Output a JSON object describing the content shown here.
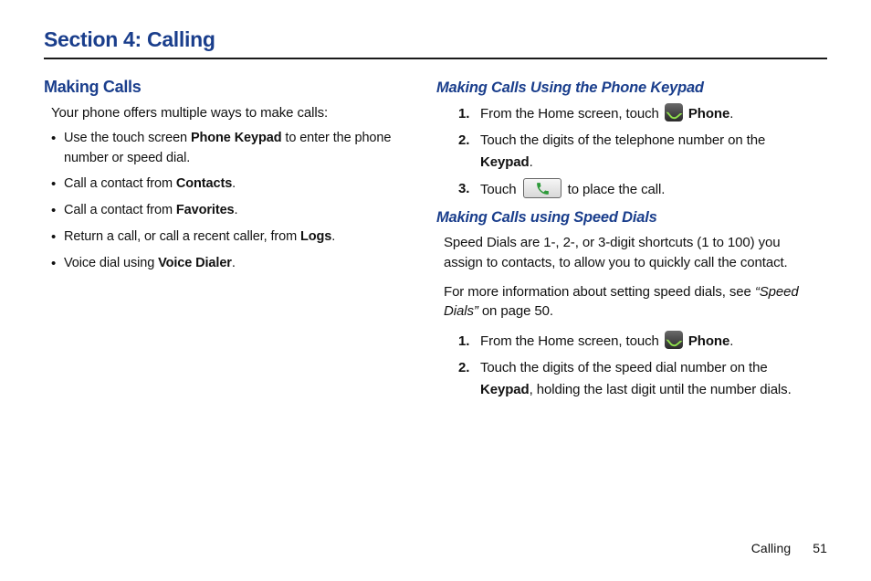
{
  "section_title": "Section 4: Calling",
  "left": {
    "h2": "Making Calls",
    "intro": "Your phone offers multiple ways to make calls:",
    "bullets": [
      {
        "pre": "Use the touch screen ",
        "bold": "Phone Keypad",
        "post": " to enter the phone number or speed dial."
      },
      {
        "pre": "Call a contact from ",
        "bold": "Contacts",
        "post": "."
      },
      {
        "pre": "Call a contact from ",
        "bold": "Favorites",
        "post": "."
      },
      {
        "pre": "Return a call, or call a recent caller, from ",
        "bold": "Logs",
        "post": "."
      },
      {
        "pre": "Voice dial using ",
        "bold": "Voice Dialer",
        "post": "."
      }
    ]
  },
  "right": {
    "sub1": {
      "h3": "Making Calls Using the Phone Keypad",
      "steps": {
        "s1_pre": "From the Home screen, touch ",
        "s1_bold": "Phone",
        "s1_post": ".",
        "s2_pre": "Touch the digits of the telephone number on the ",
        "s2_bold": "Keypad",
        "s2_post": ".",
        "s3_pre": "Touch ",
        "s3_post": " to place the call."
      }
    },
    "sub2": {
      "h3": "Making Calls using Speed Dials",
      "p1": "Speed Dials are 1-, 2-, or 3-digit shortcuts (1 to 100) you assign to contacts, to allow you to quickly call the contact.",
      "p2_pre": "For more information about setting speed dials, see ",
      "p2_ital": "“Speed Dials”",
      "p2_post": " on page 50.",
      "steps": {
        "s1_pre": "From the Home screen, touch ",
        "s1_bold": "Phone",
        "s1_post": ".",
        "s2_pre": "Touch the digits of the speed dial number on the ",
        "s2_bold": "Keypad",
        "s2_post": ", holding the last digit until the number dials."
      }
    }
  },
  "footer": {
    "label": "Calling",
    "page": "51"
  }
}
